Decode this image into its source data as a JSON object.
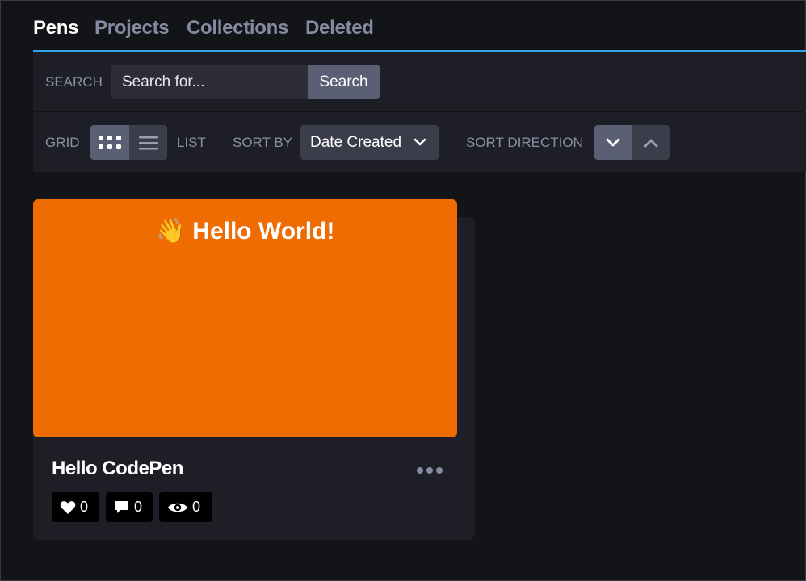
{
  "tabs": [
    {
      "label": "Pens",
      "active": true
    },
    {
      "label": "Projects",
      "active": false
    },
    {
      "label": "Collections",
      "active": false
    },
    {
      "label": "Deleted",
      "active": false
    }
  ],
  "search": {
    "label": "SEARCH",
    "placeholder": "Search for...",
    "value": "",
    "button_label": "Search"
  },
  "view": {
    "grid_label": "GRID",
    "list_label": "LIST",
    "selected": "grid",
    "grid_icon": "grid-icon",
    "list_icon": "list-icon"
  },
  "sort": {
    "label": "SORT BY",
    "selected": "Date Created",
    "direction_label": "SORT DIRECTION",
    "direction": "descending"
  },
  "pen": {
    "preview_text": "👋 Hello World!",
    "preview_color": "#ef6c02",
    "title": "Hello CodePen",
    "likes": "0",
    "comments": "0",
    "views": "0"
  },
  "colors": {
    "background": "#131417",
    "panel": "#1e1f26",
    "accent": "#2fa7e6",
    "button_active": "#5a5f73",
    "button_inactive": "#3b3d4a"
  }
}
